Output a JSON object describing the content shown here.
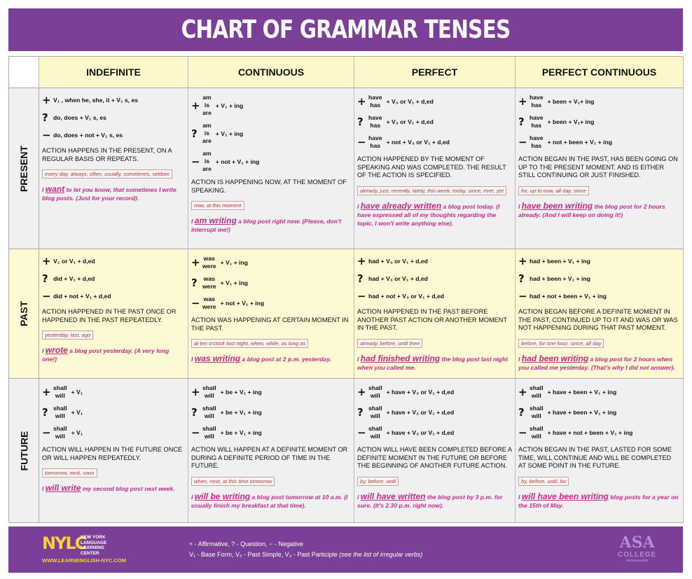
{
  "title": "CHART OF GRAMMAR TENSES",
  "columns": [
    "INDEFINITE",
    "CONTINUOUS",
    "PERFECT",
    "PERFECT CONTINUOUS"
  ],
  "rows": [
    {
      "label": "PRESENT",
      "cells": [
        {
          "formulas": [
            {
              "sym": "+",
              "rest": "V₁ , when he, she, it + V₁ s, es"
            },
            {
              "sym": "?",
              "rest": "do, does + V₁ s, es"
            },
            {
              "sym": "−",
              "rest": "do, does + not + V₁ s, es"
            }
          ],
          "desc": "ACTION HAPPENS IN THE PRESENT, ON A REGULAR BASIS OR REPEATS.",
          "markers": "every day, always, often, usually, sometimes, seldom",
          "example": {
            "pre": "I ",
            "verb": "want",
            "post": " to let you know, that sometimes I write blog posts. (Just for your record)."
          }
        },
        {
          "formulas": [
            {
              "sym": "+",
              "aux": [
                "am",
                "is",
                "are"
              ],
              "rest": "+ V₁ + ing"
            },
            {
              "sym": "?",
              "aux": [
                "am",
                "is",
                "are"
              ],
              "rest": "+ V₁ + ing"
            },
            {
              "sym": "−",
              "aux": [
                "am",
                "is",
                "are"
              ],
              "rest": "+ not + V₁ + ing"
            }
          ],
          "desc": "ACTION IS HAPPENING NOW, AT THE MOMENT OF SPEAKING.",
          "markers": "now, at this moment",
          "example": {
            "pre": "I ",
            "verb": "am writing",
            "post": " a blog post right now. (Please, don't interrupt me!)"
          }
        },
        {
          "formulas": [
            {
              "sym": "+",
              "aux": [
                "have",
                "has"
              ],
              "rest": "+ V₃ or V₁ + d,ed"
            },
            {
              "sym": "?",
              "aux": [
                "have",
                "has"
              ],
              "rest": "+ V₃ or V₁ + d,ed"
            },
            {
              "sym": "−",
              "aux": [
                "have",
                "has"
              ],
              "rest": "+ not + V₃ or V₁ + d,ed"
            }
          ],
          "desc": "ACTION HAPPENED BY THE MOMENT OF SPEAKING AND WAS COMPLETED. THE RESULT OF THE ACTION IS SPECIFIED.",
          "markers": "already, just, recently, lately, this week, today, since, ever, yet",
          "example": {
            "pre": "I ",
            "verb": "have already written",
            "post": " a blog post today. (I have expressed all of my thoughts regarding the topic, I won't write anything else)."
          }
        },
        {
          "formulas": [
            {
              "sym": "+",
              "aux": [
                "have",
                "has"
              ],
              "rest": "+ been + V₁+ ing"
            },
            {
              "sym": "?",
              "aux": [
                "have",
                "has"
              ],
              "rest": "+ been + V₁+ ing"
            },
            {
              "sym": "−",
              "aux": [
                "have",
                "has"
              ],
              "rest": "+ not + been + V₁ + ing"
            }
          ],
          "desc": "ACTION BEGAN IN THE PAST, HAS BEEN GOING ON UP TO THE PRESENT MOMENT. AND IS EITHER STILL CONTINUING OR JUST FINISHED.",
          "markers": "for, up to now, all day, since",
          "example": {
            "pre": "I ",
            "verb": "have been writing",
            "post": " the blog post for 2 hours already. (And I will keep on doing it!)"
          }
        }
      ]
    },
    {
      "label": "PAST",
      "cells": [
        {
          "formulas": [
            {
              "sym": "+",
              "rest": "V₂ or V₁ + d,ed"
            },
            {
              "sym": "?",
              "rest": "did + V₁ + d,ed"
            },
            {
              "sym": "−",
              "rest": "did + not + V₁ + d,ed"
            }
          ],
          "desc": "ACTION HAPPENED IN THE PAST ONCE OR HAPPENED IN THE PAST REPEATEDLY.",
          "markers": "yesterday, last, ago",
          "example": {
            "pre": "I ",
            "verb": "wrote",
            "post": " a blog  post yesterday. (A very long one!)"
          }
        },
        {
          "formulas": [
            {
              "sym": "+",
              "aux": [
                "was",
                "were"
              ],
              "rest": "+ V₁ + ing"
            },
            {
              "sym": "?",
              "aux": [
                "was",
                "were"
              ],
              "rest": "+ V₁ + ing"
            },
            {
              "sym": "−",
              "aux": [
                "was",
                "were"
              ],
              "rest": "+ not + V₁ + ing"
            }
          ],
          "desc": "ACTION WAS HAPPENING AT CERTAIN MOMENT IN THE PAST.",
          "markers": "at ten o'clock last night, when, while, as long as",
          "example": {
            "pre": "I ",
            "verb": "was writing",
            "post": " a blog post at 2 p.m. yesterday."
          }
        },
        {
          "formulas": [
            {
              "sym": "+",
              "rest": "had + V₃ or V₁ + d,ed"
            },
            {
              "sym": "?",
              "rest": "had + V₃ or V₁ + d,ed"
            },
            {
              "sym": "−",
              "rest": "had + not + V₃ or V₁ + d,ed"
            }
          ],
          "desc": "ACTION HAPPENED IN THE PAST BEFORE ANOTHER PAST ACTION OR ANOTHER MOMENT IN THE PAST.",
          "markers": "already, before, until then",
          "example": {
            "pre": "I ",
            "verb": "had finished writing",
            "post": " the blog post last night when you called me."
          }
        },
        {
          "formulas": [
            {
              "sym": "+",
              "rest": "had + been + V₁ + ing"
            },
            {
              "sym": "?",
              "rest": "had + been + V₁ + ing"
            },
            {
              "sym": "−",
              "rest": "had + not + been + V₁ + ing"
            }
          ],
          "desc": "ACTION BEGAN BEFORE A DEFINITE MOMENT IN THE PAST, CONTINUED UP TO IT AND WAS OR WAS NOT HAPPENING DURING THAT PAST MOMENT.",
          "markers": "before, for one hour, since, all day",
          "example": {
            "pre": "I ",
            "verb": "had been writing",
            "post": " a blog post  for 2 hours when you called me yesterday. (That's why I did not answer)."
          }
        }
      ]
    },
    {
      "label": "FUTURE",
      "cells": [
        {
          "formulas": [
            {
              "sym": "+",
              "aux": [
                "shall",
                "will"
              ],
              "rest": "+ V₁"
            },
            {
              "sym": "?",
              "aux": [
                "shall",
                "will"
              ],
              "rest": "+ V₁"
            },
            {
              "sym": "−",
              "aux": [
                "shall",
                "will"
              ],
              "rest": "+ V₁"
            }
          ],
          "desc": "ACTION WILL HAPPEN IN THE FUTURE ONCE OR WILL HAPPEN REPEATEDLY.",
          "markers": "tomorrow, next, soon",
          "example": {
            "pre": "I ",
            "verb": "will write",
            "post": " my second blog post next week."
          }
        },
        {
          "formulas": [
            {
              "sym": "+",
              "aux": [
                "shall",
                "will"
              ],
              "rest": "+ be + V₁ + ing"
            },
            {
              "sym": "?",
              "aux": [
                "shall",
                "will"
              ],
              "rest": "+ be + V₁ + ing"
            },
            {
              "sym": "−",
              "aux": [
                "shall",
                "will"
              ],
              "rest": "+ be + V₁ + ing"
            }
          ],
          "desc": "ACTION WILL HAPPEN AT A DEFINITE MOMENT OR DURING A DEFINITE PERIOD OF TIME IN THE FUTURE.",
          "markers": "when, next, at this time tomorrow",
          "example": {
            "pre": "I ",
            "verb": "will be writing",
            "post": " a blog post tomorrow at 10 a.m. (I usually finish my breakfast at that time)."
          }
        },
        {
          "formulas": [
            {
              "sym": "+",
              "aux": [
                "shall",
                "will"
              ],
              "rest": "+ have + V₃ or V₁ + d,ed"
            },
            {
              "sym": "?",
              "aux": [
                "shall",
                "will"
              ],
              "rest": "+ have + V₃ or V₁ + d,ed"
            },
            {
              "sym": "−",
              "aux": [
                "shall",
                "will"
              ],
              "rest": "+ have + V₃ or V₁ + d,ed"
            }
          ],
          "desc": "ACTION WILL HAVE BEEN COMPLETED BEFORE A DEFINITE MOMENT IN THE FUTURE OR BEFORE THE BEGINNING OF ANOTHER FUTURE ACTION.",
          "markers": "by, before, until",
          "example": {
            "pre": "I ",
            "verb": "will have written",
            "post": " the blog post by 3 p.m. for sure. (It's 2.30 p.m. right now)."
          }
        },
        {
          "formulas": [
            {
              "sym": "+",
              "aux": [
                "shall",
                "will"
              ],
              "rest": "+ have + been + V₁ + ing"
            },
            {
              "sym": "?",
              "aux": [
                "shall",
                "will"
              ],
              "rest": "+ have + been + V₁ + ing"
            },
            {
              "sym": "−",
              "aux": [
                "shall",
                "will"
              ],
              "rest": "+ have + not + been + V₁ + ing"
            }
          ],
          "desc": "ACTION BEGAN IN THE PAST, LASTED FOR SOME TIME, WILL CONTINUE AND WILL BE COMPLETED AT SOME POINT IN THE FUTURE.",
          "markers": "by, before, until, for",
          "example": {
            "pre": "I ",
            "verb": "will have been writing",
            "post": " blog posts for a year on the 15th of May."
          }
        }
      ]
    }
  ],
  "footer": {
    "logo": {
      "mark": "NYLC",
      "name": "NEW YORK LANGUAGE LEARNING CENTER",
      "url": "WWW.LEARNENGLISH-NYC.COM"
    },
    "legend_line1": "+ - Affirmative,  ? - Question,  − - Negative",
    "legend_line2": "V₁ - Base Form, V₂ - Past Simple,  V₃ - Past Participle ",
    "legend_note": "(see the list of irregular verbs)",
    "partner_logo": {
      "mark": "ASA",
      "name": "COLLEGE",
      "url": "www.asa.edu"
    }
  },
  "colors": {
    "brand_purple": "#7b3f98",
    "header_yellow": "#fdf8cc",
    "example_magenta": "#d0288c",
    "marker_red": "#b33a3a"
  }
}
